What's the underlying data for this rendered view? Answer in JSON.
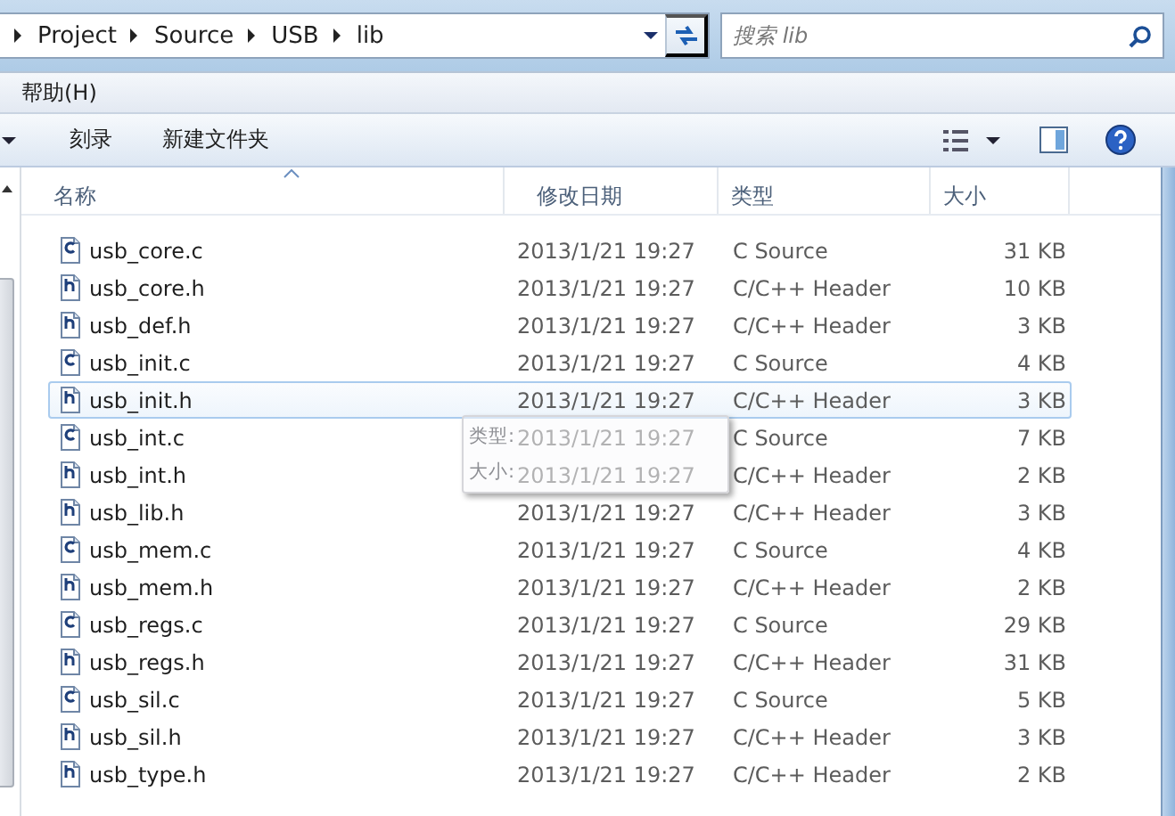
{
  "address_bar": {
    "breadcrumbs": [
      "Project",
      "Source",
      "USB",
      "lib"
    ],
    "search": {
      "placeholder": "搜索 lib"
    }
  },
  "menu_bar": {
    "items": [
      "帮助(H)"
    ]
  },
  "toolbar": {
    "buttons": [
      "刻录",
      "新建文件夹"
    ]
  },
  "table": {
    "columns": [
      {
        "label": "名称",
        "sorted": true
      },
      {
        "label": "修改日期",
        "sorted": false
      },
      {
        "label": "类型",
        "sorted": false
      },
      {
        "label": "大小",
        "sorted": false
      }
    ],
    "rows": [
      {
        "name": "usb_core.c",
        "kind": "c",
        "modified": "2013/1/21 19:27",
        "type": "C Source",
        "size": "31 KB",
        "hovered": false
      },
      {
        "name": "usb_core.h",
        "kind": "h",
        "modified": "2013/1/21 19:27",
        "type": "C/C++ Header",
        "size": "10 KB",
        "hovered": false
      },
      {
        "name": "usb_def.h",
        "kind": "h",
        "modified": "2013/1/21 19:27",
        "type": "C/C++ Header",
        "size": "3 KB",
        "hovered": false
      },
      {
        "name": "usb_init.c",
        "kind": "c",
        "modified": "2013/1/21 19:27",
        "type": "C Source",
        "size": "4 KB",
        "hovered": false
      },
      {
        "name": "usb_init.h",
        "kind": "h",
        "modified": "2013/1/21 19:27",
        "type": "C/C++ Header",
        "size": "3 KB",
        "hovered": true
      },
      {
        "name": "usb_int.c",
        "kind": "c",
        "modified": "2013/1/21 19:27",
        "type": "C Source",
        "size": "7 KB",
        "hovered": false
      },
      {
        "name": "usb_int.h",
        "kind": "h",
        "modified": "2013/1/21 19:27",
        "type": "C/C++ Header",
        "size": "2 KB",
        "hovered": false
      },
      {
        "name": "usb_lib.h",
        "kind": "h",
        "modified": "2013/1/21 19:27",
        "type": "C/C++ Header",
        "size": "3 KB",
        "hovered": false
      },
      {
        "name": "usb_mem.c",
        "kind": "c",
        "modified": "2013/1/21 19:27",
        "type": "C Source",
        "size": "4 KB",
        "hovered": false
      },
      {
        "name": "usb_mem.h",
        "kind": "h",
        "modified": "2013/1/21 19:27",
        "type": "C/C++ Header",
        "size": "2 KB",
        "hovered": false
      },
      {
        "name": "usb_regs.c",
        "kind": "c",
        "modified": "2013/1/21 19:27",
        "type": "C Source",
        "size": "29 KB",
        "hovered": false
      },
      {
        "name": "usb_regs.h",
        "kind": "h",
        "modified": "2013/1/21 19:27",
        "type": "C/C++ Header",
        "size": "31 KB",
        "hovered": false
      },
      {
        "name": "usb_sil.c",
        "kind": "c",
        "modified": "2013/1/21 19:27",
        "type": "C Source",
        "size": "5 KB",
        "hovered": false
      },
      {
        "name": "usb_sil.h",
        "kind": "h",
        "modified": "2013/1/21 19:27",
        "type": "C/C++ Header",
        "size": "3 KB",
        "hovered": false
      },
      {
        "name": "usb_type.h",
        "kind": "h",
        "modified": "2013/1/21 19:27",
        "type": "C/C++ Header",
        "size": "2 KB",
        "hovered": false
      }
    ]
  },
  "tooltip": {
    "lines": [
      "类型:",
      "大小:"
    ]
  }
}
